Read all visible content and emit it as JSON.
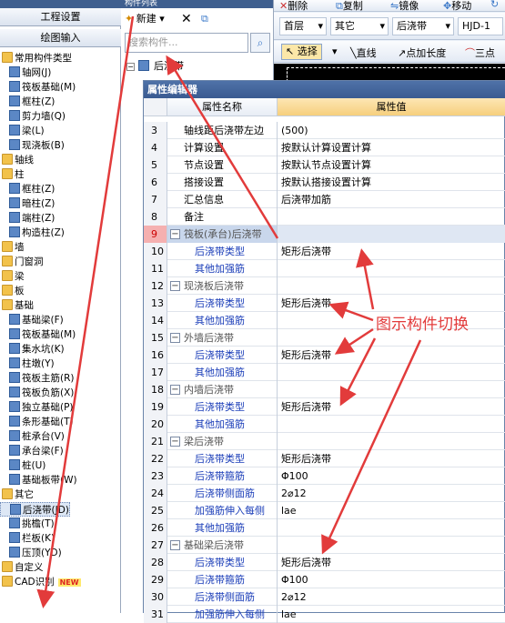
{
  "left_nav": {
    "tab_project_settings": "工程设置",
    "tab_drawing_input": "绘图输入",
    "tree": [
      {
        "label": "常用构件类型",
        "level": 0,
        "kind": "folder"
      },
      {
        "label": "轴网(J)",
        "level": 1,
        "kind": "comp"
      },
      {
        "label": "筏板基础(M)",
        "level": 1,
        "kind": "comp"
      },
      {
        "label": "框柱(Z)",
        "level": 1,
        "kind": "comp"
      },
      {
        "label": "剪力墙(Q)",
        "level": 1,
        "kind": "comp"
      },
      {
        "label": "梁(L)",
        "level": 1,
        "kind": "comp"
      },
      {
        "label": "现浇板(B)",
        "level": 1,
        "kind": "comp"
      },
      {
        "label": "轴线",
        "level": 0,
        "kind": "folder"
      },
      {
        "label": "柱",
        "level": 0,
        "kind": "folder"
      },
      {
        "label": "框柱(Z)",
        "level": 1,
        "kind": "comp"
      },
      {
        "label": "暗柱(Z)",
        "level": 1,
        "kind": "comp"
      },
      {
        "label": "端柱(Z)",
        "level": 1,
        "kind": "comp"
      },
      {
        "label": "构造柱(Z)",
        "level": 1,
        "kind": "comp"
      },
      {
        "label": "墙",
        "level": 0,
        "kind": "folder"
      },
      {
        "label": "门窗洞",
        "level": 0,
        "kind": "folder"
      },
      {
        "label": "梁",
        "level": 0,
        "kind": "folder"
      },
      {
        "label": "板",
        "level": 0,
        "kind": "folder"
      },
      {
        "label": "基础",
        "level": 0,
        "kind": "folder"
      },
      {
        "label": "基础梁(F)",
        "level": 1,
        "kind": "comp"
      },
      {
        "label": "筏板基础(M)",
        "level": 1,
        "kind": "comp"
      },
      {
        "label": "集水坑(K)",
        "level": 1,
        "kind": "comp"
      },
      {
        "label": "柱墩(Y)",
        "level": 1,
        "kind": "comp"
      },
      {
        "label": "筏板主筋(R)",
        "level": 1,
        "kind": "comp"
      },
      {
        "label": "筏板负筋(X)",
        "level": 1,
        "kind": "comp"
      },
      {
        "label": "独立基础(P)",
        "level": 1,
        "kind": "comp"
      },
      {
        "label": "条形基础(T)",
        "level": 1,
        "kind": "comp"
      },
      {
        "label": "桩承台(V)",
        "level": 1,
        "kind": "comp"
      },
      {
        "label": "承台梁(F)",
        "level": 1,
        "kind": "comp"
      },
      {
        "label": "桩(U)",
        "level": 1,
        "kind": "comp"
      },
      {
        "label": "基础板带(W)",
        "level": 1,
        "kind": "comp"
      },
      {
        "label": "其它",
        "level": 0,
        "kind": "folder"
      },
      {
        "label": "后浇带(JD)",
        "level": 1,
        "kind": "comp",
        "selected": true
      },
      {
        "label": "挑檐(T)",
        "level": 1,
        "kind": "comp"
      },
      {
        "label": "栏板(K)",
        "level": 1,
        "kind": "comp"
      },
      {
        "label": "压顶(YD)",
        "level": 1,
        "kind": "comp"
      },
      {
        "label": "自定义",
        "level": 0,
        "kind": "folder"
      },
      {
        "label": "CAD识别",
        "level": 0,
        "kind": "folder",
        "badge": "NEW"
      }
    ]
  },
  "comp_list": {
    "title": "构件列表",
    "new_label": "新建",
    "search_placeholder": "搜索构件...",
    "tree_root": "后浇带"
  },
  "toolbar": {
    "delete": "删除",
    "copy": "复制",
    "mirror": "镜像",
    "move": "移动",
    "floor": "首层",
    "category": "其它",
    "component": "后浇带",
    "instance": "HJD-1",
    "select": "选择",
    "line": "直线",
    "point_length": "点加长度",
    "three_point": "三点"
  },
  "prop_editor": {
    "title": "属性编辑器",
    "col_name": "属性名称",
    "col_value": "属性值",
    "rows": [
      {
        "n": "3",
        "name": "轴线距后浇带左边",
        "value": "(500)",
        "type": "normal"
      },
      {
        "n": "4",
        "name": "计算设置",
        "value": "按默认计算设置计算",
        "type": "normal"
      },
      {
        "n": "5",
        "name": "节点设置",
        "value": "按默认节点设置计算",
        "type": "normal"
      },
      {
        "n": "6",
        "name": "搭接设置",
        "value": "按默认搭接设置计算",
        "type": "normal"
      },
      {
        "n": "7",
        "name": "汇总信息",
        "value": "后浇带加筋",
        "type": "normal"
      },
      {
        "n": "8",
        "name": "备注",
        "value": "",
        "type": "normal"
      },
      {
        "n": "9",
        "name": "筏板(承台)后浇带",
        "value": "",
        "type": "group",
        "highlight": true
      },
      {
        "n": "10",
        "name": "后浇带类型",
        "value": "矩形后浇带",
        "type": "child"
      },
      {
        "n": "11",
        "name": "其他加强筋",
        "value": "",
        "type": "child"
      },
      {
        "n": "12",
        "name": "现浇板后浇带",
        "value": "",
        "type": "group"
      },
      {
        "n": "13",
        "name": "后浇带类型",
        "value": "矩形后浇带",
        "type": "child"
      },
      {
        "n": "14",
        "name": "其他加强筋",
        "value": "",
        "type": "child"
      },
      {
        "n": "15",
        "name": "外墙后浇带",
        "value": "",
        "type": "group"
      },
      {
        "n": "16",
        "name": "后浇带类型",
        "value": "矩形后浇带",
        "type": "child"
      },
      {
        "n": "17",
        "name": "其他加强筋",
        "value": "",
        "type": "child"
      },
      {
        "n": "18",
        "name": "内墙后浇带",
        "value": "",
        "type": "group"
      },
      {
        "n": "19",
        "name": "后浇带类型",
        "value": "矩形后浇带",
        "type": "child"
      },
      {
        "n": "20",
        "name": "其他加强筋",
        "value": "",
        "type": "child"
      },
      {
        "n": "21",
        "name": "梁后浇带",
        "value": "",
        "type": "group"
      },
      {
        "n": "22",
        "name": "后浇带类型",
        "value": "矩形后浇带",
        "type": "child"
      },
      {
        "n": "23",
        "name": "后浇带箍筋",
        "value": "Φ100",
        "type": "child"
      },
      {
        "n": "24",
        "name": "后浇带侧面筋",
        "value": "2⌀12",
        "type": "child"
      },
      {
        "n": "25",
        "name": "加强筋伸入每侧",
        "value": "lae",
        "type": "child"
      },
      {
        "n": "26",
        "name": "其他加强筋",
        "value": "",
        "type": "child"
      },
      {
        "n": "27",
        "name": "基础梁后浇带",
        "value": "",
        "type": "group"
      },
      {
        "n": "28",
        "name": "后浇带类型",
        "value": "矩形后浇带",
        "type": "child"
      },
      {
        "n": "29",
        "name": "后浇带箍筋",
        "value": "Φ100",
        "type": "child"
      },
      {
        "n": "30",
        "name": "后浇带侧面筋",
        "value": "2⌀12",
        "type": "child"
      },
      {
        "n": "31",
        "name": "加强筋伸入每侧",
        "value": "lae",
        "type": "child"
      }
    ]
  },
  "annotation": {
    "text": "图示构件切换",
    "color": "#e23b3b"
  }
}
